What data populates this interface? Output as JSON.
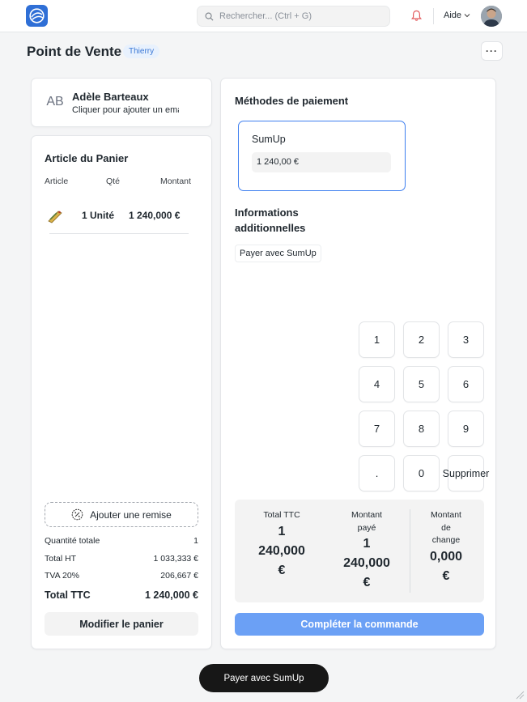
{
  "topbar": {
    "search_placeholder": "Rechercher... (Ctrl + G)",
    "help_label": "Aide"
  },
  "page": {
    "title": "Point de Vente",
    "user_badge": "Thierry"
  },
  "customer": {
    "initials": "AB",
    "name": "Adèle Barteaux",
    "subtitle": "Cliquer pour ajouter un email"
  },
  "cart": {
    "title": "Article du Panier",
    "columns": [
      "Article",
      "Qté",
      "Montant"
    ],
    "items": [
      {
        "icon": "product-thumbnail",
        "qty": "1 Unité",
        "amount": "1 240,000 €"
      }
    ],
    "discount_label": "Ajouter une remise",
    "summary": [
      {
        "label": "Quantité totale",
        "value": "1"
      },
      {
        "label": "Total HT",
        "value": "1 033,333 €"
      },
      {
        "label": "TVA 20%",
        "value": "206,667 €"
      },
      {
        "label": "Total TTC",
        "value": "1 240,000 €"
      }
    ],
    "modify_label": "Modifier le panier"
  },
  "payment": {
    "title": "Méthodes de paiement",
    "method": {
      "name": "SumUp",
      "amount": "1 240,00 €"
    },
    "info_title": "Informations additionnelles",
    "pay_sumup_small": "Payer avec SumUp",
    "keypad": [
      "1",
      "2",
      "3",
      "4",
      "5",
      "6",
      "7",
      "8",
      "9",
      ".",
      "0",
      "Supprimer"
    ],
    "totals": {
      "ttc_label": "Total TTC",
      "ttc_value": [
        "1",
        "240,000",
        "€"
      ],
      "paid_label": [
        "Montant",
        "payé"
      ],
      "paid_value": [
        "1",
        "240,000",
        "€"
      ],
      "change_label": [
        "Montant",
        "de",
        "change"
      ],
      "change_value": [
        "0,000",
        "€"
      ]
    },
    "complete_label": "Compléter la commande"
  },
  "footer": {
    "pay_button": "Payer avec SumUp"
  },
  "colors": {
    "accent": "#3e7ff0",
    "complete_button": "#6ba0f5",
    "badge_bg": "#e8f1fd",
    "badge_text": "#3a78d6",
    "dark_button": "#171717"
  }
}
